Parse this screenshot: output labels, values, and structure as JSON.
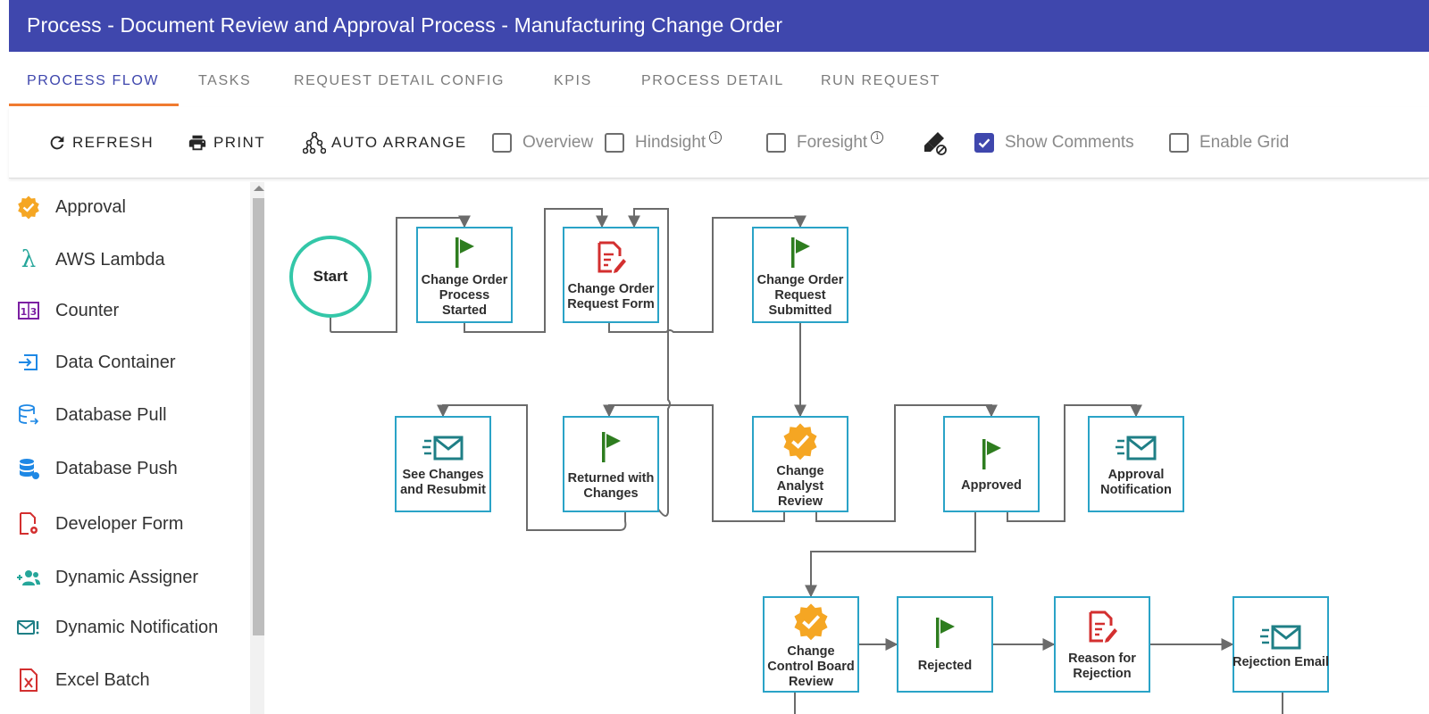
{
  "window": {
    "title": "Process - Document Review and Approval Process - Manufacturing Change Order"
  },
  "tabs": [
    "PROCESS FLOW",
    "TASKS",
    "REQUEST DETAIL CONFIG",
    "KPIS",
    "PROCESS DETAIL",
    "RUN REQUEST"
  ],
  "toolbar": {
    "refresh": "REFRESH",
    "print": "PRINT",
    "auto_arrange": "AUTO ARRANGE",
    "overview": {
      "label": "Overview",
      "checked": false
    },
    "hindsight": {
      "label": "Hindsight",
      "checked": false
    },
    "foresight": {
      "label": "Foresight",
      "checked": false
    },
    "show_comments": {
      "label": "Show Comments",
      "checked": true
    },
    "enable_grid": {
      "label": "Enable Grid",
      "checked": false
    }
  },
  "palette": [
    {
      "label": "Approval",
      "icon": "approval-badge-icon"
    },
    {
      "label": "AWS Lambda",
      "icon": "lambda-icon"
    },
    {
      "label": "Counter",
      "icon": "counter-icon"
    },
    {
      "label": "Data Container",
      "icon": "data-container-icon"
    },
    {
      "label": "Database Pull",
      "icon": "database-pull-icon"
    },
    {
      "label": "Database Push",
      "icon": "database-push-icon"
    },
    {
      "label": "Developer Form",
      "icon": "developer-form-icon"
    },
    {
      "label": "Dynamic Assigner",
      "icon": "dynamic-assigner-icon"
    },
    {
      "label": "Dynamic Notification",
      "icon": "dynamic-notification-icon"
    },
    {
      "label": "Excel Batch",
      "icon": "excel-batch-icon"
    }
  ],
  "flow": {
    "start": "Start",
    "nodes": {
      "change_order_started": "Change Order Process Started",
      "change_order_form": "Change Order Request Form",
      "change_order_submitted": "Change Order Request Submitted",
      "see_changes": "See Changes and Resubmit",
      "returned": "Returned with Changes",
      "analyst_review": "Change Analyst Review",
      "approved": "Approved",
      "approval_notification": "Approval Notification",
      "ccb_review": "Change Control Board Review",
      "rejected": "Rejected",
      "reason_rejection": "Reason for Rejection",
      "rejection_email": "Rejection Email"
    }
  },
  "colors": {
    "header": "#3f47ad",
    "active_tab_underline": "#f07a2f",
    "node_border": "#2aa3c7",
    "start_ring": "#33c7a8",
    "flag": "#2e7d1f",
    "form_red": "#d32f2f",
    "approval_gold": "#f5a623",
    "mail_teal": "#1f7f86"
  }
}
